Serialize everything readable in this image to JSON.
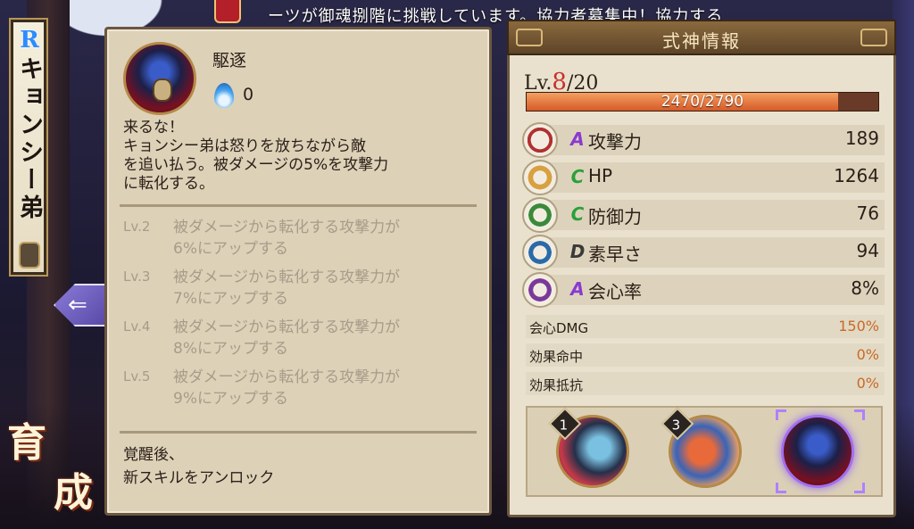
{
  "ticker": "ーツが御魂捌階に挑戦しています。協力者募集中！協力する",
  "shikigami": {
    "rarity": "R",
    "name": "キョンシー弟"
  },
  "nav": {
    "back_glyph": "⇐",
    "ikusei_char1": "育",
    "ikusei_char2": "成"
  },
  "skill": {
    "name": "駆逐",
    "onibi_cost": "0",
    "desc_lines": [
      "来るな！",
      "キョンシー弟は怒りを放ちながら敵",
      "を追い払う。被ダメージの5%を攻撃力",
      "に転化する。"
    ],
    "levels": [
      {
        "tag": "Lv.2",
        "line1": "被ダメージから転化する攻撃力が",
        "line2": "6%にアップする"
      },
      {
        "tag": "Lv.3",
        "line1": "被ダメージから転化する攻撃力が",
        "line2": "7%にアップする"
      },
      {
        "tag": "Lv.4",
        "line1": "被ダメージから転化する攻撃力が",
        "line2": "8%にアップする"
      },
      {
        "tag": "Lv.5",
        "line1": "被ダメージから転化する攻撃力が",
        "line2": "9%にアップする"
      }
    ],
    "awaken_line1": "覚醒後、",
    "awaken_line2": "新スキルをアンロック"
  },
  "stats": {
    "header": "式神情報",
    "level_prefix": "Lv.",
    "level": "8",
    "level_max": "/20",
    "xp_text": "2470/2790",
    "xp_fraction": 0.885,
    "rows": [
      {
        "grade": "A",
        "name": "攻撃力",
        "value": "189",
        "icon": "attack-icon"
      },
      {
        "grade": "C",
        "name": "HP",
        "value": "1264",
        "icon": "hp-icon"
      },
      {
        "grade": "C",
        "name": "防御力",
        "value": "76",
        "icon": "defense-icon"
      },
      {
        "grade": "D",
        "name": "素早さ",
        "value": "94",
        "icon": "speed-icon"
      },
      {
        "grade": "A",
        "name": "会心率",
        "value": "8%",
        "icon": "crit-rate-icon"
      }
    ],
    "sub_rows": [
      {
        "name": "会心DMG",
        "value": "150%"
      },
      {
        "name": "効果命中",
        "value": "0%"
      },
      {
        "name": "効果抵抗",
        "value": "0%"
      }
    ],
    "skill_slots": [
      {
        "num": "1"
      },
      {
        "num": "3"
      }
    ]
  }
}
